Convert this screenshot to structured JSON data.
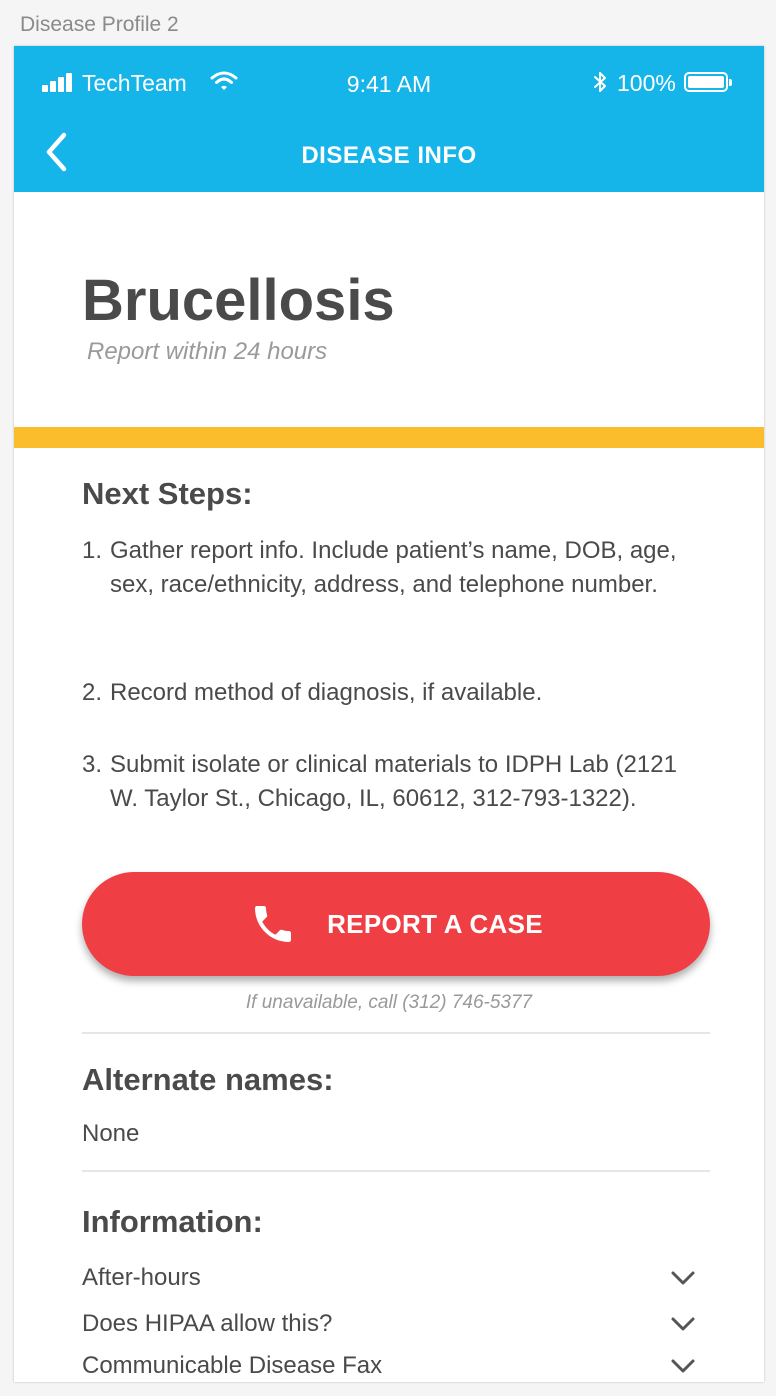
{
  "artboard_label": "Disease Profile 2",
  "status_bar": {
    "carrier": "TechTeam",
    "time": "9:41 AM",
    "battery": "100%",
    "icons": [
      "signal-icon",
      "wifi-icon",
      "bluetooth-icon",
      "battery-icon"
    ]
  },
  "nav": {
    "title": "DISEASE INFO",
    "back_icon": "chevron-left-icon"
  },
  "disease": {
    "name": "Brucellosis",
    "report_window": "Report within 24 hours"
  },
  "next_steps": {
    "heading": "Next Steps:",
    "items": [
      {
        "num": "1.",
        "text": "Gather report info. Include patient’s name, DOB, age, sex, race/ethnicity, address, and telephone number."
      },
      {
        "num": "2.",
        "text": "Record method of diagnosis, if available."
      },
      {
        "num": "3.",
        "text": "Submit isolate or clinical materials to IDPH Lab (2121 W. Taylor St., Chicago, IL, 60612, 312-793-1322)."
      }
    ]
  },
  "report_button": {
    "label": "REPORT A CASE",
    "icon": "phone-icon",
    "fallback": "If unavailable, call (312) 746-5377"
  },
  "alternate_names": {
    "heading": "Alternate names:",
    "value": "None"
  },
  "information": {
    "heading": "Information:",
    "items": [
      {
        "label": "After-hours"
      },
      {
        "label": "Does HIPAA allow this?"
      },
      {
        "label": "Communicable Disease Fax"
      }
    ]
  },
  "colors": {
    "header": "#15b5ea",
    "accent": "#fbbd2c",
    "button": "#ef3e44",
    "text": "#4a4a4a"
  }
}
